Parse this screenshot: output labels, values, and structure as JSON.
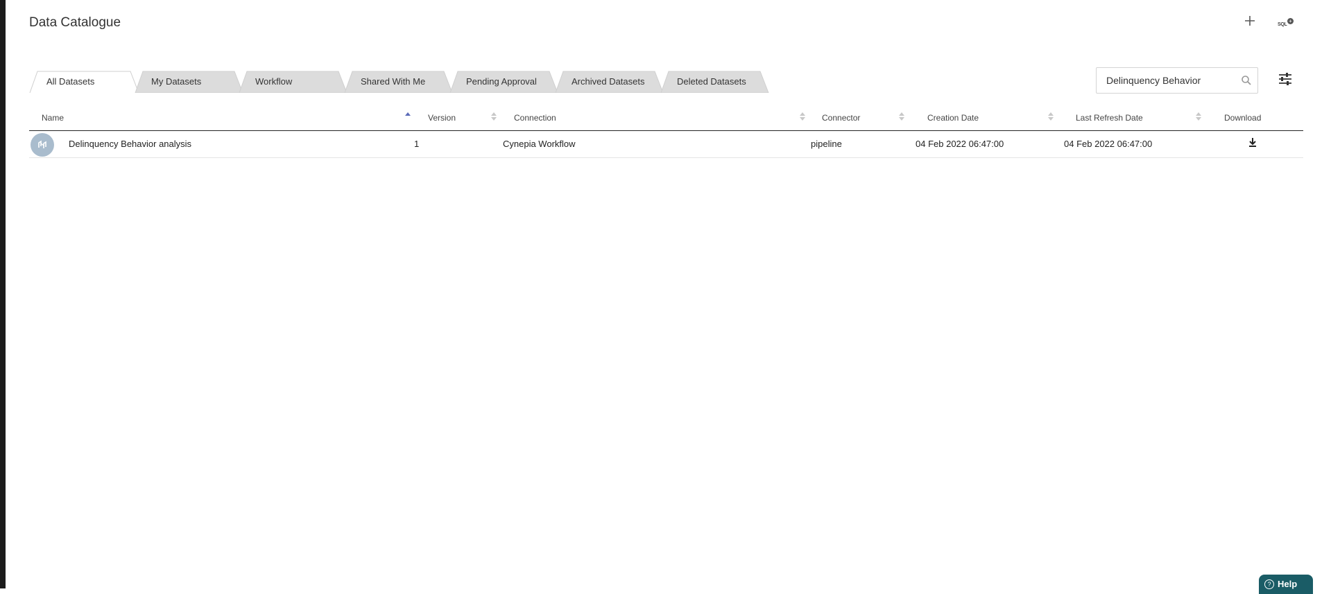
{
  "page": {
    "title": "Data Catalogue"
  },
  "header": {
    "add_icon": "plus-icon",
    "sql_icon": "sql-add-icon",
    "sql_label": "SQL"
  },
  "tabs": [
    {
      "label": "All Datasets",
      "active": true
    },
    {
      "label": "My Datasets",
      "active": false
    },
    {
      "label": "Workflow",
      "active": false
    },
    {
      "label": "Shared With Me",
      "active": false
    },
    {
      "label": "Pending Approval",
      "active": false
    },
    {
      "label": "Archived Datasets",
      "active": false
    },
    {
      "label": "Deleted Datasets",
      "active": false
    }
  ],
  "search": {
    "value": "Delinquency Behavior",
    "placeholder": "Search"
  },
  "table": {
    "columns": [
      "Name",
      "Version",
      "Connection",
      "Connector",
      "Creation Date",
      "Last Refresh Date",
      "Download"
    ],
    "sorted_by": "Name",
    "sort_direction": "asc",
    "rows": [
      {
        "name": "Delinquency Behavior analysis",
        "version": "1",
        "connection": "Cynepia Workflow",
        "connector": "pipeline",
        "creation_date": "04 Feb 2022 06:47:00",
        "last_refresh_date": "04 Feb 2022 06:47:00",
        "download_icon": "download-icon"
      }
    ]
  },
  "help": {
    "label": "Help"
  },
  "colors": {
    "accent": "#5b6bb8",
    "help_button": "#1a5c66",
    "avatar": "#a9bccd",
    "tab_inactive": "#dcdcdc"
  }
}
